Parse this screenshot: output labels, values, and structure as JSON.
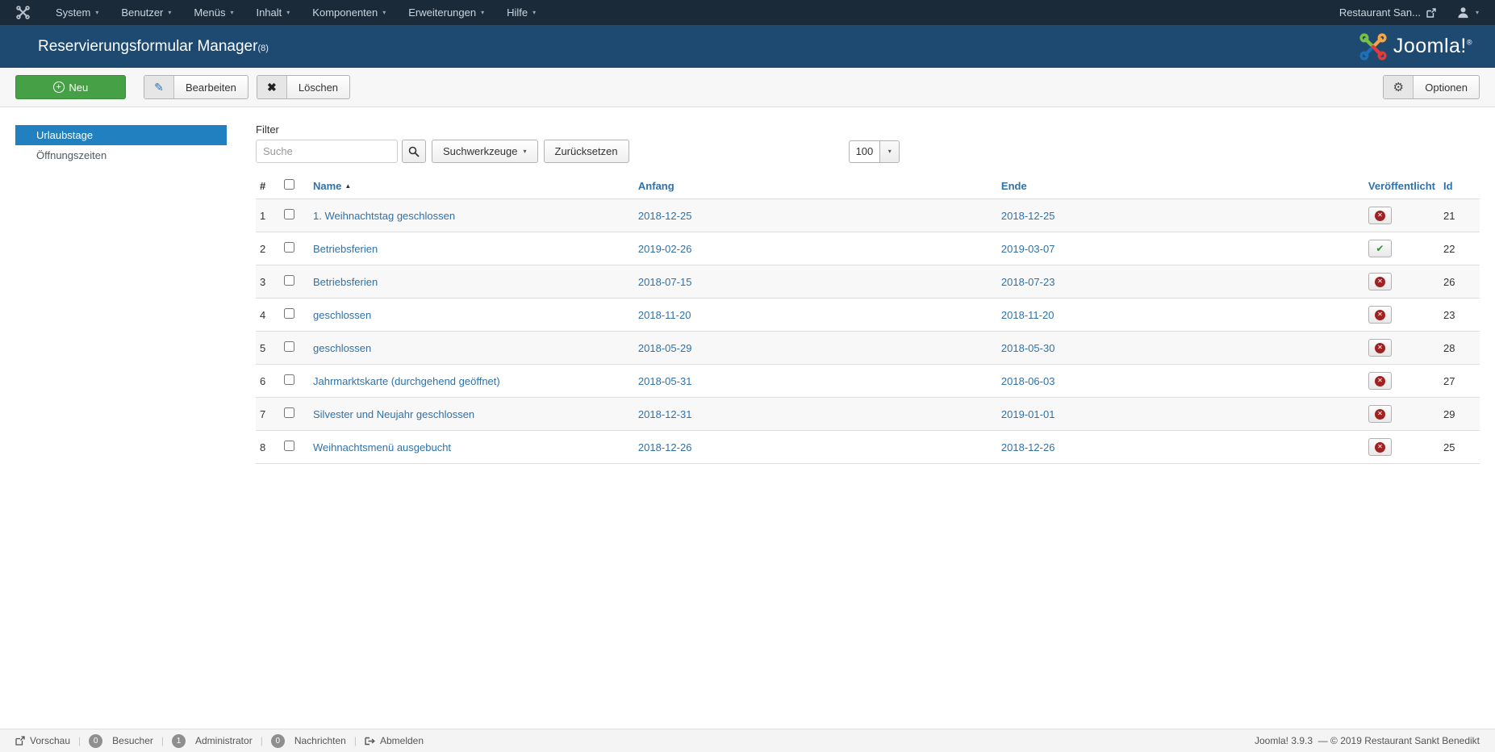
{
  "icons": {
    "caret_down": "▾",
    "select_caret": "▾",
    "sort_asc": "▲",
    "plus": "+",
    "edit": "✎",
    "delete": "✖",
    "gear": "⚙",
    "check": "✔",
    "cross": "✕",
    "registered": "®"
  },
  "navbar": {
    "items": [
      {
        "label": "System"
      },
      {
        "label": "Benutzer"
      },
      {
        "label": "Menüs"
      },
      {
        "label": "Inhalt"
      },
      {
        "label": "Komponenten"
      },
      {
        "label": "Erweiterungen"
      },
      {
        "label": "Hilfe"
      }
    ],
    "site_link": "Restaurant San..."
  },
  "header": {
    "title": "Reservierungsformular Manager",
    "title_suffix": "(8)",
    "logo_text": "Joomla!"
  },
  "toolbar": {
    "new_label": "Neu",
    "edit_label": "Bearbeiten",
    "delete_label": "Löschen",
    "options_label": "Optionen"
  },
  "sidebar": {
    "items": [
      {
        "label": "Urlaubstage"
      },
      {
        "label": "Öffnungszeiten"
      }
    ]
  },
  "filter": {
    "label": "Filter",
    "search_placeholder": "Suche",
    "search_tools_label": "Suchwerkzeuge",
    "reset_label": "Zurücksetzen",
    "limit_value": "100"
  },
  "table": {
    "headers": {
      "num": "#",
      "name": "Name",
      "start": "Anfang",
      "end": "Ende",
      "published": "Veröffentlicht",
      "id": "Id"
    },
    "rows": [
      {
        "num": "1",
        "name": "1. Weihnachtstag geschlossen",
        "start": "2018-12-25",
        "end": "2018-12-25",
        "published": "unpublished",
        "id": "21"
      },
      {
        "num": "2",
        "name": "Betriebsferien",
        "start": "2019-02-26",
        "end": "2019-03-07",
        "published": "published",
        "id": "22"
      },
      {
        "num": "3",
        "name": "Betriebsferien",
        "start": "2018-07-15",
        "end": "2018-07-23",
        "published": "unpublished",
        "id": "26"
      },
      {
        "num": "4",
        "name": "geschlossen",
        "start": "2018-11-20",
        "end": "2018-11-20",
        "published": "unpublished",
        "id": "23"
      },
      {
        "num": "5",
        "name": "geschlossen",
        "start": "2018-05-29",
        "end": "2018-05-30",
        "published": "unpublished",
        "id": "28"
      },
      {
        "num": "6",
        "name": "Jahrmarktskarte (durchgehend geöffnet)",
        "start": "2018-05-31",
        "end": "2018-06-03",
        "published": "unpublished",
        "id": "27"
      },
      {
        "num": "7",
        "name": "Silvester und Neujahr geschlossen",
        "start": "2018-12-31",
        "end": "2019-01-01",
        "published": "unpublished",
        "id": "29"
      },
      {
        "num": "8",
        "name": "Weihnachtsmenü ausgebucht",
        "start": "2018-12-26",
        "end": "2018-12-26",
        "published": "unpublished",
        "id": "25"
      }
    ]
  },
  "footer": {
    "separator": "|",
    "preview_label": "Vorschau",
    "visitors_badge": "0",
    "visitors_label": "Besucher",
    "admin_badge": "1",
    "admin_label": "Administrator",
    "messages_badge": "0",
    "messages_label": "Nachrichten",
    "logout_label": "Abmelden",
    "version": "Joomla! 3.9.3",
    "copyright": "—  © 2019 Restaurant Sankt Benedikt"
  },
  "colors": {
    "navbar_bg": "#1b2a38",
    "header_bg": "#1e4a72",
    "accent_blue": "#2080c0",
    "link_blue": "#3071a9",
    "success_green": "#46a046",
    "unpublished_red": "#a02121"
  }
}
